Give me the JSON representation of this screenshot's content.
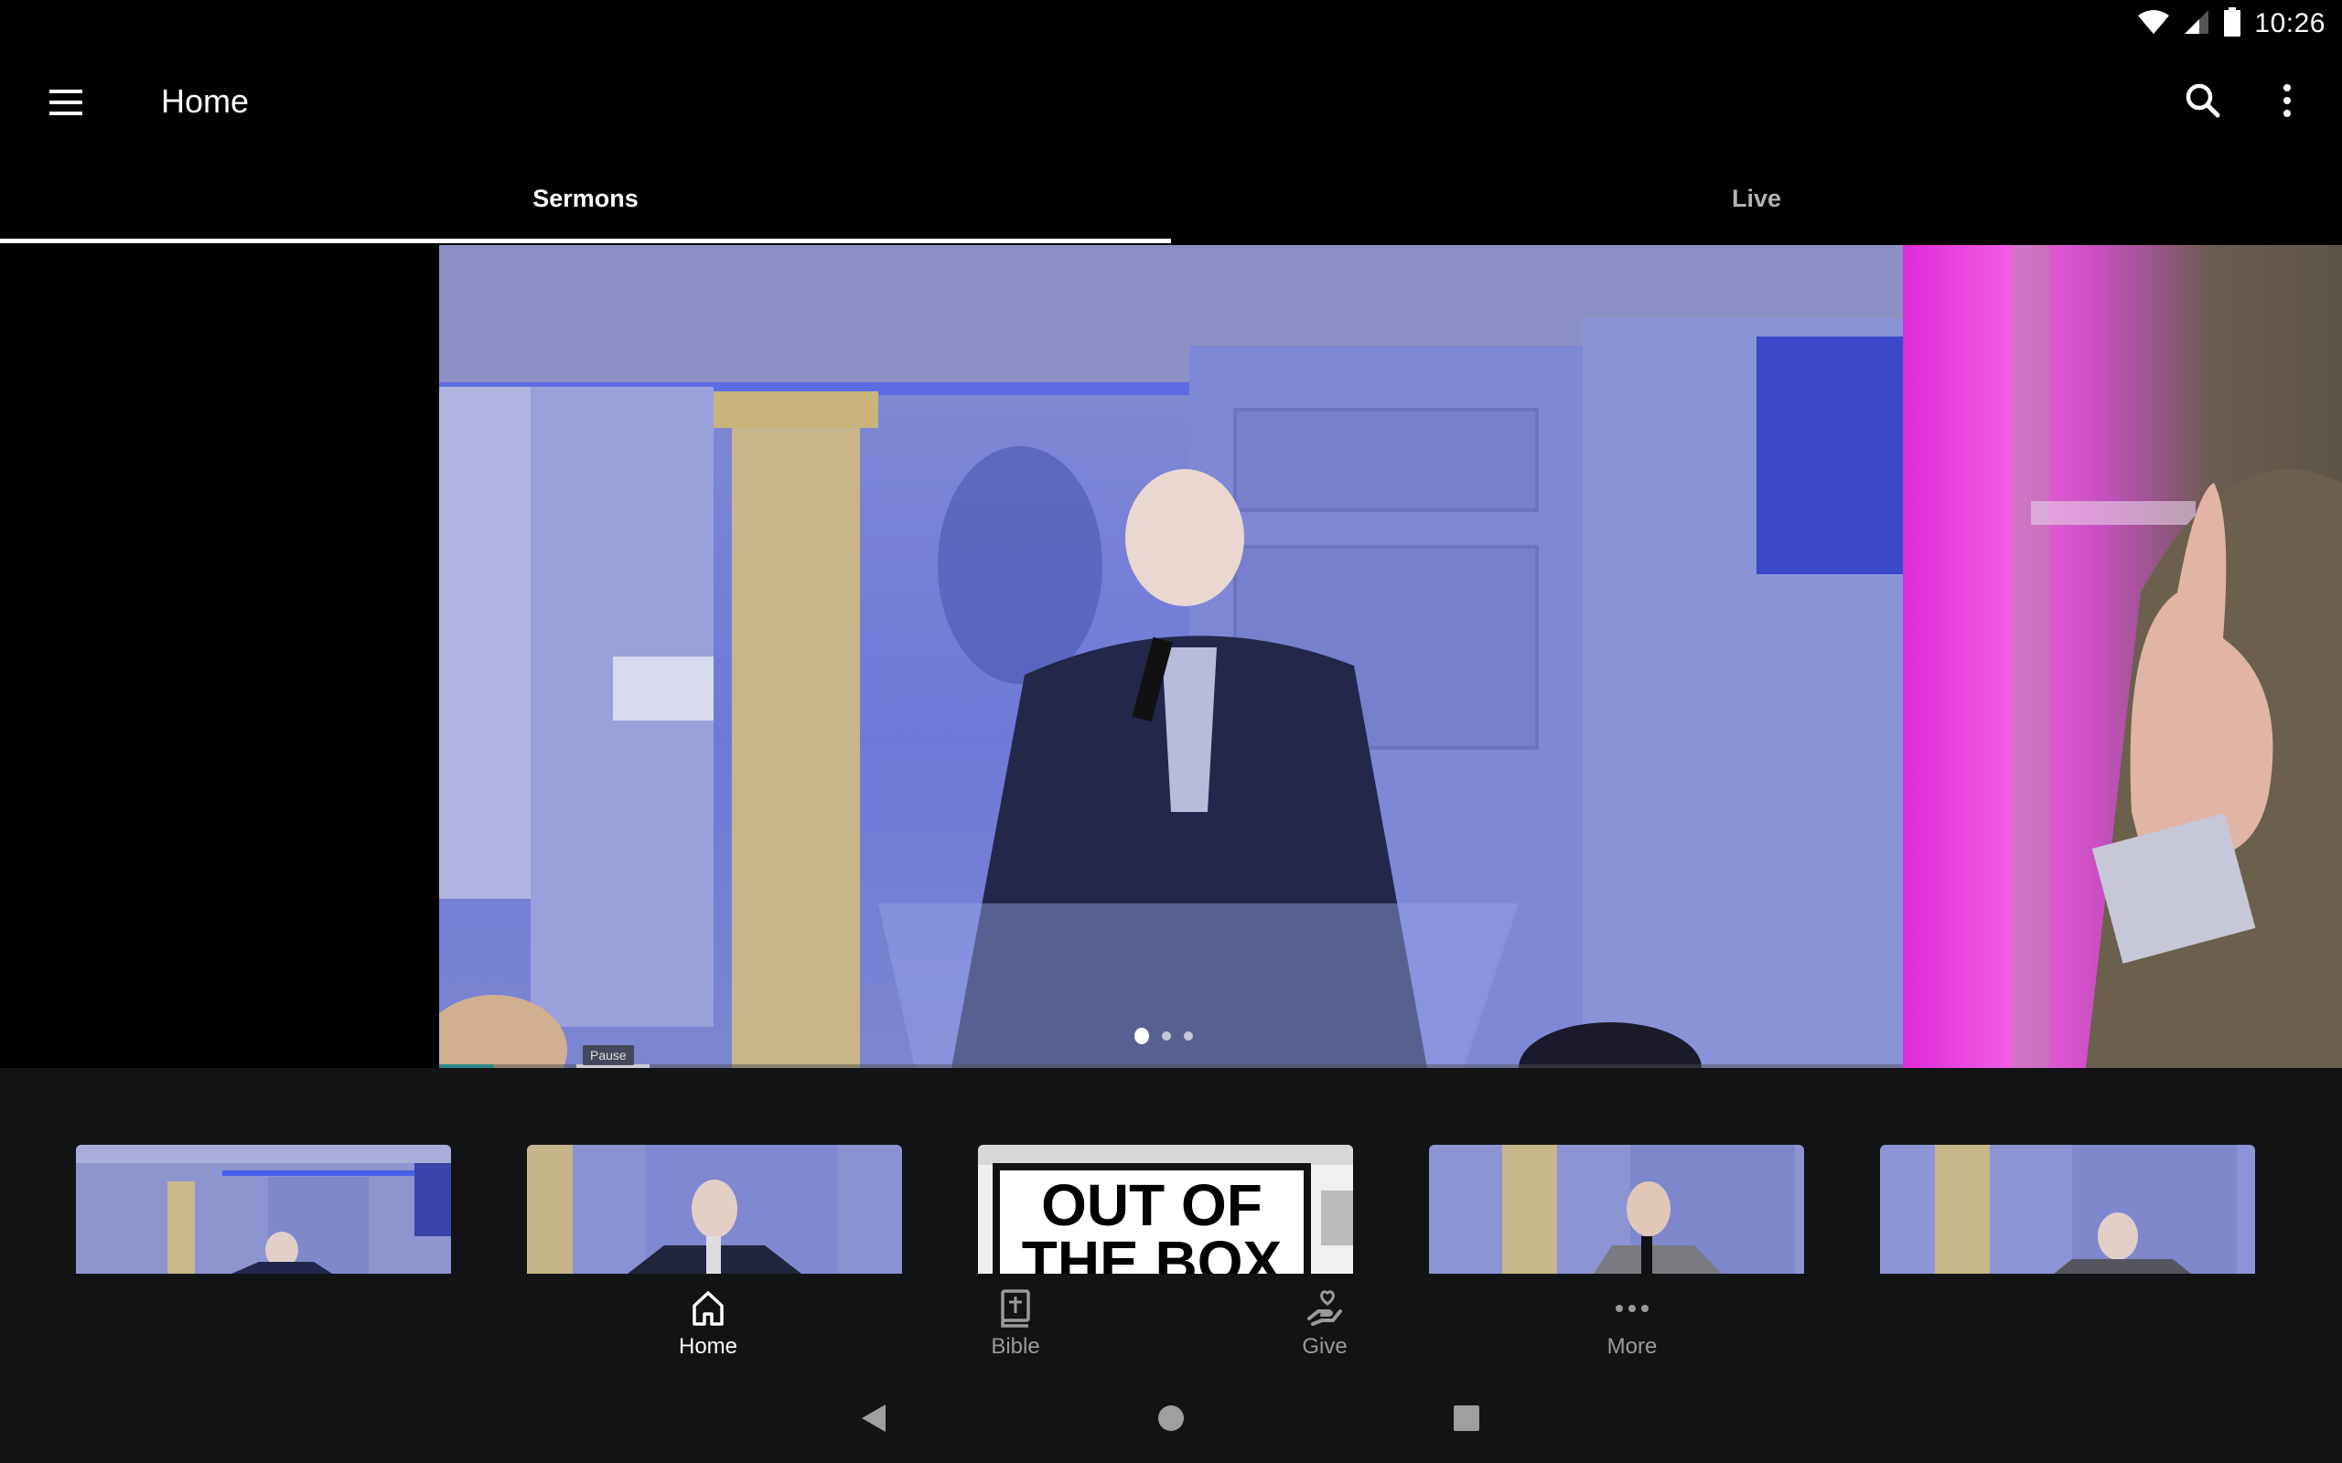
{
  "status_bar": {
    "time": "10:26",
    "icons": [
      "wifi-icon",
      "cell-signal-icon",
      "battery-icon"
    ]
  },
  "app_bar": {
    "title": "Home",
    "menu_icon": "hamburger-menu-icon",
    "actions": [
      {
        "name": "search",
        "icon": "search-icon"
      },
      {
        "name": "overflow-menu",
        "icon": "more-vert-icon"
      }
    ]
  },
  "tabs": [
    {
      "label": "Sermons",
      "selected": true
    },
    {
      "label": "Live",
      "selected": false
    }
  ],
  "hero": {
    "pager": {
      "count": 3,
      "active_index": 0
    },
    "player_tooltip": "Pause"
  },
  "thumbnails": [
    {
      "description": "Speaker at pulpit with microphone, blue-lit stage"
    },
    {
      "description": "Speaker in dark suit holding microphone"
    },
    {
      "description": "OUT OF THE BOX sermon series graphic",
      "overlay_text": "OUT OF THE BOX"
    },
    {
      "description": "Speaker with glasses holding microphone"
    },
    {
      "description": "Speaker seated with microphone"
    }
  ],
  "bottom_nav": [
    {
      "label": "Home",
      "icon": "home-icon",
      "active": true
    },
    {
      "label": "Bible",
      "icon": "bible-icon",
      "active": false
    },
    {
      "label": "Give",
      "icon": "give-hand-heart-icon",
      "active": false
    },
    {
      "label": "More",
      "icon": "more-horiz-icon",
      "active": false
    }
  ],
  "system_nav": [
    "back",
    "home",
    "recents"
  ],
  "colors": {
    "background": "#000000",
    "surface": "#121315",
    "active": "#ffffff",
    "inactive": "#9a9a9a"
  }
}
